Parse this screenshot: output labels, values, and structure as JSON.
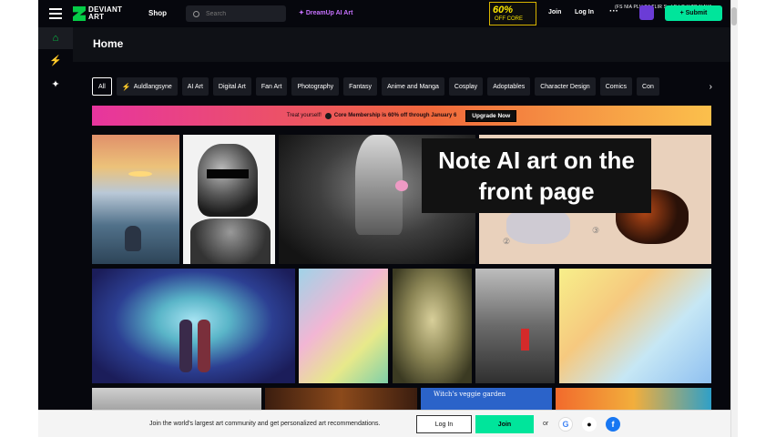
{
  "topbar": {
    "logo_line1": "DEVIANT",
    "logo_line2": "ART",
    "shop": "Shop",
    "search_placeholder": "Search",
    "dreamup": "DreamUp AI Art",
    "promo_pct": "60%",
    "promo_sub": "OFF CORE",
    "join": "Join",
    "login": "Log In",
    "more": "···",
    "submit": "+ Submit",
    "overlay_caption": "(FS NIA PLU S4 TLIR S...LE LO Y TO N NIA"
  },
  "rail": {
    "items": [
      {
        "name": "home-icon",
        "glyph": "⌂",
        "active": true
      },
      {
        "name": "bolt-icon",
        "glyph": "⚡",
        "active": false
      },
      {
        "name": "dreamup-icon",
        "glyph": "✦",
        "active": false
      }
    ]
  },
  "page": {
    "title": "Home"
  },
  "chips": [
    {
      "label": "All",
      "active": true
    },
    {
      "label": "Auldlangsyne",
      "bolt": true
    },
    {
      "label": "AI Art"
    },
    {
      "label": "Digital Art"
    },
    {
      "label": "Fan Art"
    },
    {
      "label": "Photography"
    },
    {
      "label": "Fantasy"
    },
    {
      "label": "Anime and Manga"
    },
    {
      "label": "Cosplay"
    },
    {
      "label": "Adoptables"
    },
    {
      "label": "Character Design"
    },
    {
      "label": "Comics"
    },
    {
      "label": "Con"
    }
  ],
  "banner": {
    "treat": "Treat yourself!",
    "message": "Core Membership is 60% off through January 6",
    "upgrade": "Upgrade Now"
  },
  "note": {
    "line1": "Note AI art on the",
    "line2": "front page"
  },
  "gallery": {
    "tile4_num2": "②",
    "tile4_num3": "③",
    "tile12_title": "Witch's veggie garden"
  },
  "signup": {
    "text": "Join the world's largest art community and get personalized art recommendations.",
    "login": "Log In",
    "join": "Join",
    "or": "or"
  },
  "colors": {
    "accent": "#00e59b",
    "logo_green": "#05cc47",
    "background": "#06070d"
  }
}
